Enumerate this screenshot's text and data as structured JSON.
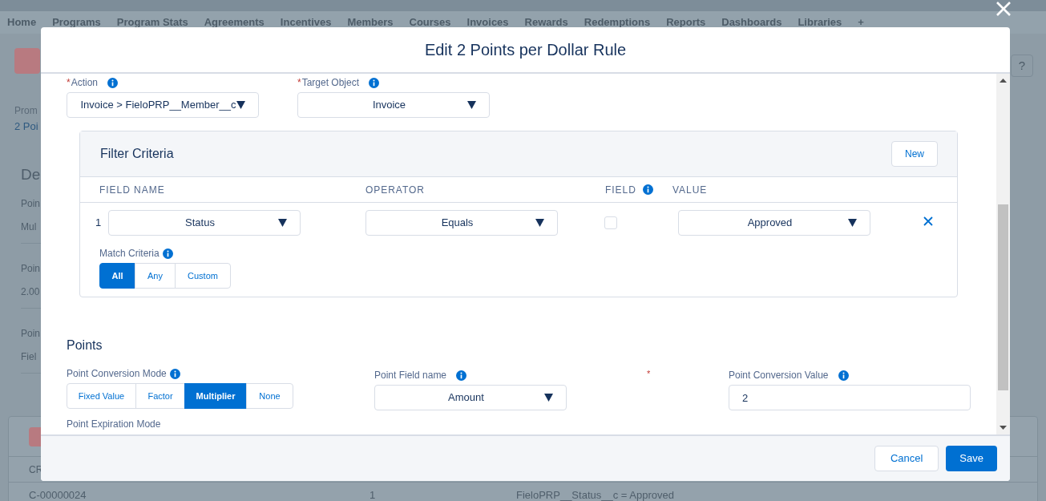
{
  "background": {
    "nav_tabs": [
      "Home",
      "Programs",
      "Program Stats",
      "Agreements",
      "Incentives",
      "Members",
      "Courses",
      "Invoices",
      "Rewards",
      "Redemptions",
      "Reports",
      "Dashboards",
      "Libraries",
      "+"
    ],
    "help_button": "?",
    "breadcrumb": "Prom",
    "record_link": "2 Poi",
    "section_title": "De",
    "fields": [
      {
        "label": "Poin",
        "value": "Mul"
      },
      {
        "label": "Poin",
        "value": "2.00"
      },
      {
        "label": "Poin",
        "value": "Fiel"
      }
    ],
    "related_header": "CR",
    "related_row": [
      "C-00000024",
      "1",
      "FieloPRP__Status__c = Approved"
    ]
  },
  "modal": {
    "title": "Edit 2 Points per Dollar Rule",
    "action": {
      "required_mark": "*",
      "label": "Action",
      "value": "Invoice > FieloPRP__Member__c"
    },
    "target_object": {
      "required_mark": "*",
      "label": "Target Object",
      "value": "Invoice"
    },
    "filter_criteria": {
      "title": "Filter Criteria",
      "new_button": "New",
      "columns": [
        {
          "label": "FIELD NAME",
          "info": false
        },
        {
          "label": "OPERATOR",
          "info": false
        },
        {
          "label": "FIELD",
          "info": true
        },
        {
          "label": "VALUE",
          "info": false
        }
      ],
      "rows": [
        {
          "index": "1",
          "field": "Status",
          "operator": "Equals",
          "field_checked": false,
          "value": "Approved"
        }
      ],
      "match_criteria": {
        "label": "Match Criteria",
        "options": [
          {
            "label": "All",
            "selected": true
          },
          {
            "label": "Any",
            "selected": false
          },
          {
            "label": "Custom",
            "selected": false
          }
        ]
      }
    },
    "points": {
      "heading": "Points",
      "conversion_mode": {
        "label": "Point Conversion Mode",
        "options": [
          {
            "label": "Fixed Value",
            "selected": false
          },
          {
            "label": "Factor",
            "selected": false
          },
          {
            "label": "Multiplier",
            "selected": true
          },
          {
            "label": "None",
            "selected": false
          }
        ]
      },
      "point_field_name": {
        "label": "Point Field name",
        "value": "Amount"
      },
      "asterisk": "*",
      "conversion_value": {
        "label": "Point Conversion Value",
        "value": "2"
      },
      "expiration_mode": {
        "label": "Point Expiration Mode"
      }
    },
    "buttons": {
      "cancel": "Cancel",
      "save": "Save"
    }
  }
}
